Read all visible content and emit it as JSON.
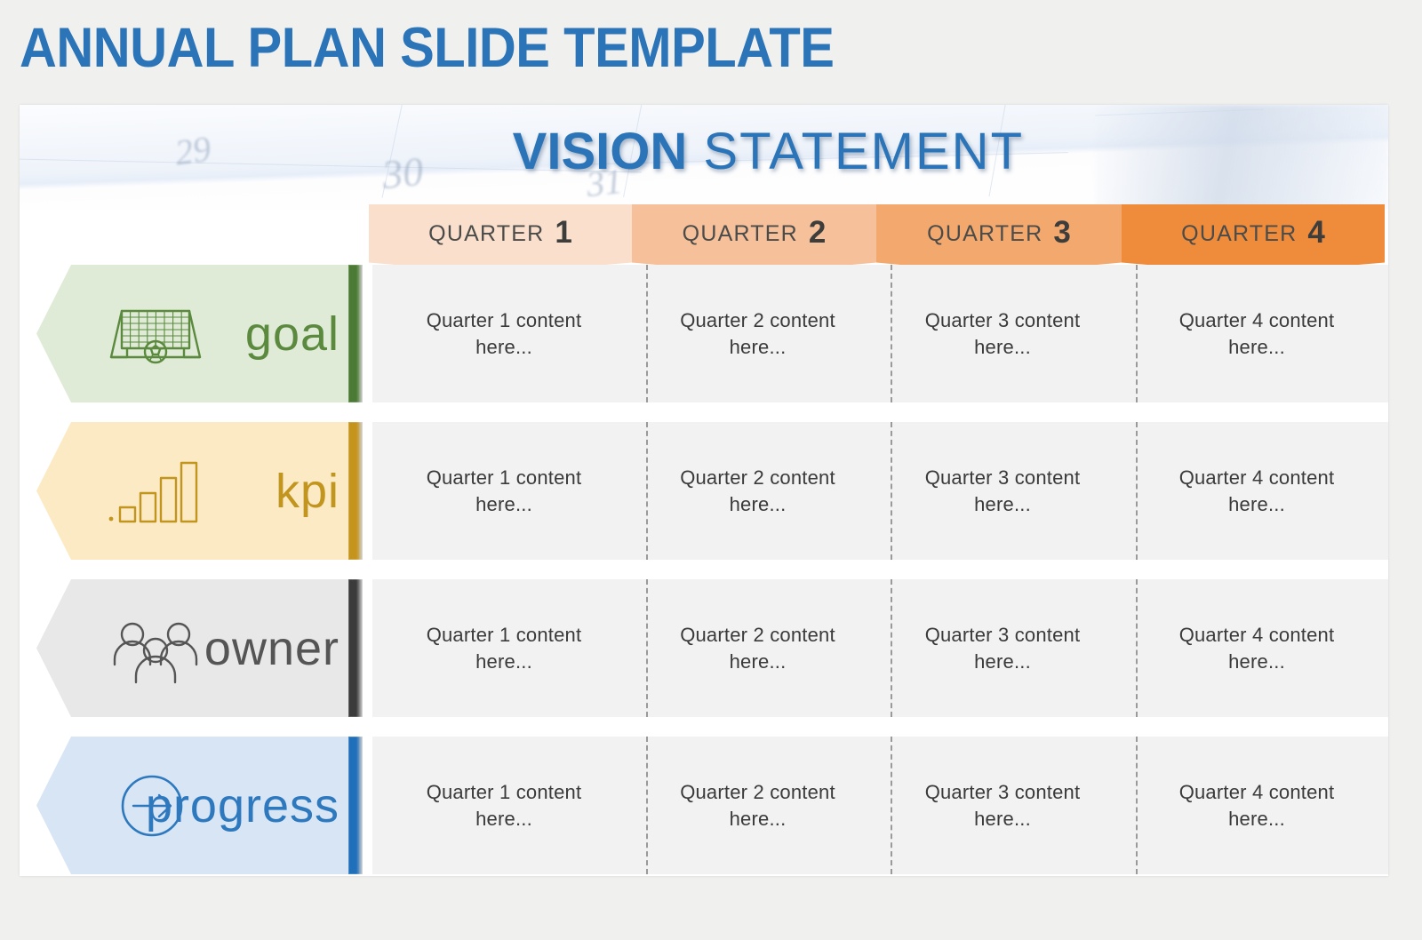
{
  "page": {
    "title": "ANNUAL PLAN SLIDE TEMPLATE",
    "background_color": "#f0f0ef",
    "title_color": "#2B74B8"
  },
  "banner": {
    "vision_bold": "VISION",
    "vision_light": " STATEMENT",
    "calendar_numbers": [
      "29",
      "30",
      "31"
    ]
  },
  "quarters": [
    {
      "label": "QUARTER",
      "number": "1",
      "color": "#f9dfcc"
    },
    {
      "label": "QUARTER",
      "number": "2",
      "color": "#f6c09a"
    },
    {
      "label": "QUARTER",
      "number": "3",
      "color": "#f3a86d"
    },
    {
      "label": "QUARTER",
      "number": "4",
      "color": "#ef8c3c"
    }
  ],
  "rows": [
    {
      "label": "goal",
      "icon": "soccer-goal-icon",
      "fill_color": "#dfebd7",
      "bar_color": "#4a7a33",
      "text_color": "#5b8a3e",
      "cells": [
        "Quarter 1 content here...",
        "Quarter 2 content here...",
        "Quarter 3 content here...",
        "Quarter 4 content here..."
      ]
    },
    {
      "label": "kpi",
      "icon": "bar-chart-icon",
      "fill_color": "#fbeac4",
      "bar_color": "#c4941c",
      "text_color": "#c2951f",
      "cells": [
        "Quarter 1 content here...",
        "Quarter 2 content here...",
        "Quarter 3 content here...",
        "Quarter 4 content here..."
      ]
    },
    {
      "label": "owner",
      "icon": "people-group-icon",
      "fill_color": "#e8e8e8",
      "bar_color": "#3b3b3b",
      "text_color": "#555555",
      "cells": [
        "Quarter 1 content here...",
        "Quarter 2 content here...",
        "Quarter 3 content here...",
        "Quarter 4 content here..."
      ]
    },
    {
      "label": "progress",
      "icon": "circle-arrow-right-icon",
      "fill_color": "#d7e5f5",
      "bar_color": "#1f6fba",
      "text_color": "#2E78BE",
      "cells": [
        "Quarter 1 content here...",
        "Quarter 2 content here...",
        "Quarter 3 content here...",
        "Quarter 4 content here..."
      ]
    }
  ]
}
